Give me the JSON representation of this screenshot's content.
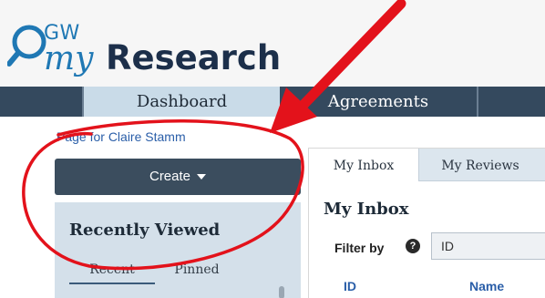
{
  "app": {
    "logo_gw": "GW",
    "logo_my": "my",
    "logo_research": "Research"
  },
  "nav": {
    "tabs": [
      {
        "label": "Dashboard"
      },
      {
        "label": "Agreements"
      }
    ]
  },
  "sidebar": {
    "page_for": "Page for Claire Stamm",
    "create_label": "Create",
    "recently_viewed": "Recently Viewed",
    "tabs": [
      {
        "label": "Recent"
      },
      {
        "label": "Pinned"
      }
    ]
  },
  "inbox": {
    "tabs": [
      {
        "label": "My Inbox"
      },
      {
        "label": "My Reviews"
      }
    ],
    "title": "My Inbox",
    "filter_label": "Filter by",
    "help_glyph": "?",
    "filter_value": "ID",
    "columns": [
      {
        "label": "ID"
      },
      {
        "label": "Name"
      }
    ]
  },
  "colors": {
    "navbar": "#34495e",
    "active_tab": "#c9dbe8",
    "annotation": "#e3121b",
    "link": "#2a5ea8"
  }
}
